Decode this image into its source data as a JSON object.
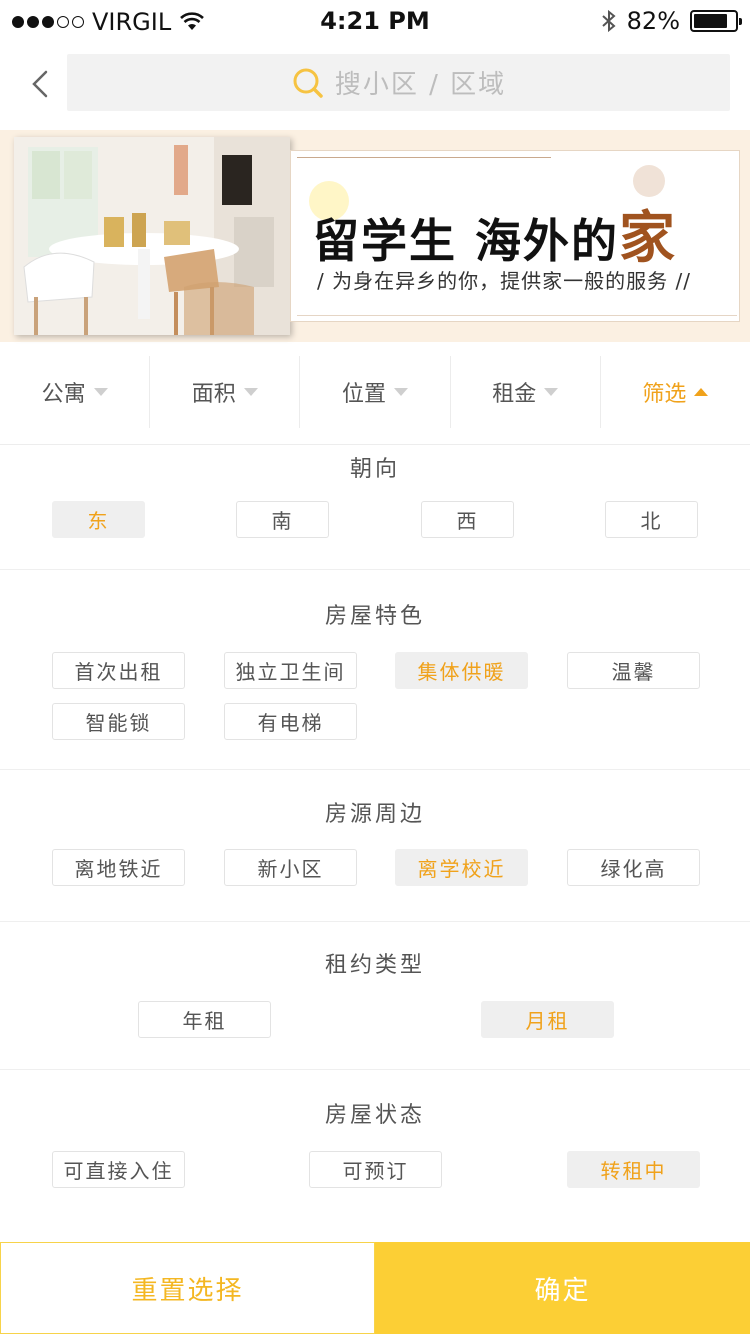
{
  "status_bar": {
    "carrier": "VIRGIL",
    "time": "4:21 PM",
    "battery": "82%",
    "battery_level": 0.82
  },
  "search": {
    "placeholder": "搜小区 / 区域",
    "back_icon": "chevron-left-icon",
    "search_icon": "search-icon"
  },
  "banner": {
    "title_main": "留学生 海外的",
    "title_accent": "家",
    "subtitle": "/ 为身在异乡的你，提供家一般的服务 //"
  },
  "tabs": [
    {
      "label": "公寓",
      "active": false
    },
    {
      "label": "面积",
      "active": false
    },
    {
      "label": "位置",
      "active": false
    },
    {
      "label": "租金",
      "active": false
    },
    {
      "label": "筛选",
      "active": true
    }
  ],
  "filters": {
    "orientation": {
      "title": "朝向",
      "options": [
        {
          "label": "东",
          "selected": true
        },
        {
          "label": "南",
          "selected": false
        },
        {
          "label": "西",
          "selected": false
        },
        {
          "label": "北",
          "selected": false
        }
      ]
    },
    "features": {
      "title": "房屋特色",
      "options": [
        {
          "label": "首次出租",
          "selected": false
        },
        {
          "label": "独立卫生间",
          "selected": false
        },
        {
          "label": "集体供暖",
          "selected": true
        },
        {
          "label": "温馨",
          "selected": false
        },
        {
          "label": "智能锁",
          "selected": false
        },
        {
          "label": "有电梯",
          "selected": false
        }
      ]
    },
    "surroundings": {
      "title": "房源周边",
      "options": [
        {
          "label": "离地铁近",
          "selected": false
        },
        {
          "label": "新小区",
          "selected": false
        },
        {
          "label": "离学校近",
          "selected": true
        },
        {
          "label": "绿化高",
          "selected": false
        }
      ]
    },
    "lease_type": {
      "title": "租约类型",
      "options": [
        {
          "label": "年租",
          "selected": false
        },
        {
          "label": "月租",
          "selected": true
        }
      ]
    },
    "status": {
      "title": "房屋状态",
      "options": [
        {
          "label": "可直接入住",
          "selected": false
        },
        {
          "label": "可预订",
          "selected": false
        },
        {
          "label": "转租中",
          "selected": true
        }
      ]
    }
  },
  "bottom": {
    "reset_label": "重置选择",
    "confirm_label": "确定"
  },
  "colors": {
    "accent": "#f0a21b",
    "confirm_bg": "#fccf35",
    "banner_bg": "#fbf0e2",
    "banner_accent": "#a0531f"
  }
}
